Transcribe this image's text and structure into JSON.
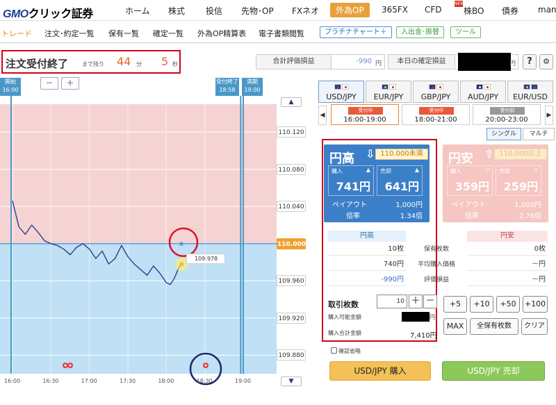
{
  "topnav": {
    "logo_gmo": "GMO",
    "logo_rest": "クリック証券",
    "items": [
      "ホーム",
      "株式",
      "投信",
      "先物･OP",
      "FXネオ",
      "外為OP",
      "365FX",
      "CFD",
      "株BO",
      "債券",
      "manc"
    ]
  },
  "subnav": {
    "items": [
      "トレード",
      "注文･約定一覧",
      "保有一覧",
      "確定一覧",
      "外為OP精算表",
      "電子書類閲覧"
    ],
    "buttons": [
      "プラチナチャート＋",
      "入出金･振替",
      "ツール"
    ]
  },
  "status": {
    "order_closed": "注文受付終了",
    "remaining": "まで残り",
    "minutes": "44",
    "min_unit": "分",
    "seconds": "5",
    "sec_unit": "秒",
    "unrealized_label": "合計評価損益",
    "unrealized_value": "-990",
    "realized_label": "本日の確定損益",
    "yen": "円",
    "help": "?",
    "settings": "⚙"
  },
  "chart": {
    "open_label": "開始",
    "open_time": "16:00",
    "close_label": "受付終了",
    "close_time": "18:58",
    "expiry_label": "満期",
    "expiry_time": "19:00",
    "zoom_out": "－",
    "zoom_in": "＋",
    "scroll_up": "▲",
    "scroll_down": "▼",
    "current_price_tag": "109.978",
    "colors": {
      "upper_zone": "#f6d3d3",
      "lower_zone": "#bfe0f5",
      "line": "#2b3f8a",
      "marker": "#4a98c8"
    }
  },
  "chart_data": {
    "type": "line",
    "series": [
      {
        "x": [
          "16:00",
          "16:05",
          "16:10",
          "16:15",
          "16:20",
          "16:25",
          "16:30",
          "16:35",
          "16:40",
          "16:45",
          "16:50",
          "16:55",
          "17:00",
          "17:05",
          "17:10",
          "17:15",
          "17:20",
          "17:25",
          "17:30",
          "17:35",
          "17:40",
          "17:45",
          "17:50",
          "17:55",
          "18:00",
          "18:03",
          "18:06",
          "18:10",
          "18:12"
        ],
        "values": [
          110.046,
          110.018,
          110.01,
          110.02,
          110.012,
          110.003,
          110.0,
          109.998,
          109.994,
          109.988,
          109.996,
          110.0,
          109.994,
          109.984,
          109.992,
          109.978,
          109.984,
          109.998,
          109.986,
          109.978,
          109.972,
          109.966,
          109.976,
          109.968,
          109.958,
          109.956,
          109.962,
          109.975,
          109.978
        ]
      }
    ],
    "ylim": [
      109.86,
      110.15
    ],
    "y_ticks": [
      110.12,
      110.08,
      110.04,
      110.0,
      109.96,
      109.92,
      109.88
    ],
    "y_tick_labels": [
      "110.120",
      "110.080",
      "110.040",
      "110.000",
      "109.960",
      "109.920",
      "109.880"
    ],
    "x_ticks": [
      "16:00",
      "16:30",
      "17:00",
      "17:30",
      "18:00",
      "18:30",
      "19:00"
    ],
    "target_price": 110.0,
    "current_price": 109.978,
    "grid": true
  },
  "pairs": [
    {
      "label": "USD/JPY",
      "flags": [
        "us",
        "jp"
      ]
    },
    {
      "label": "EUR/JPY",
      "flags": [
        "eu",
        "jp"
      ]
    },
    {
      "label": "GBP/JPY",
      "flags": [
        "gb",
        "jp"
      ]
    },
    {
      "label": "AUD/JPY",
      "flags": [
        "au",
        "jp"
      ]
    },
    {
      "label": "EUR/USD",
      "flags": [
        "eu",
        "us"
      ]
    }
  ],
  "sessions": [
    {
      "status": "受付中",
      "time": "16:00-19:00"
    },
    {
      "status": "受付中",
      "time": "18:00-21:00"
    },
    {
      "status": "受付前",
      "time": "20:00-23:00"
    }
  ],
  "session_prev": "◀",
  "session_next": "▶",
  "modes": [
    "シングル",
    "マルチ"
  ],
  "up_card": {
    "title": "円高",
    "arrow": "⇩",
    "threshold": "110.000未満",
    "buy_label": "購入",
    "buy_price": "741円",
    "sell_label": "売却",
    "sell_price": "641円",
    "payout_label": "ペイアウト",
    "payout_value": "1,000円",
    "ratio_label": "倍率",
    "ratio_value": "1.34倍"
  },
  "down_card": {
    "title": "円安",
    "arrow": "⇧",
    "threshold": "110.000以上",
    "buy_label": "購入",
    "buy_price": "359円",
    "sell_label": "売却",
    "sell_price": "259円",
    "payout_label": "ペイアウト",
    "payout_value": "1,000円",
    "ratio_label": "倍率",
    "ratio_value": "2.78倍"
  },
  "positions": {
    "left_head": "円高",
    "right_head": "円安",
    "rows": [
      {
        "label": "保有枚数",
        "left": "10枚",
        "right": "0枚"
      },
      {
        "label": "平均購入価格",
        "left": "740円",
        "right": "－円"
      },
      {
        "label": "評価損益",
        "left": "-990円",
        "right": "－円"
      }
    ]
  },
  "order": {
    "qty_label": "取引枚数",
    "qty_value": "10",
    "plus": "＋",
    "minus": "－",
    "available_label": "購入可能金額",
    "available_yen": "円",
    "total_label": "購入合計金額",
    "total_value": "7,410円",
    "adds": [
      "+5",
      "+10",
      "+50",
      "+100"
    ],
    "max": "MAX",
    "all_positions": "全保有枚数",
    "clear": "クリア",
    "confirm_skip": "確認省略",
    "buy_button": "USD/JPY 購入",
    "sell_button": "USD/JPY 売却"
  }
}
